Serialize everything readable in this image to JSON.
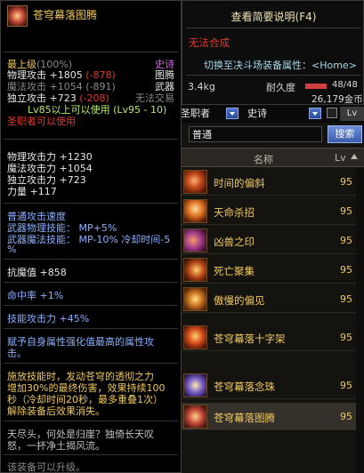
{
  "tooltip": {
    "item_name": "苍穹幕落图腾",
    "grade_label": "最上级",
    "grade_pct": "(100%)",
    "rarity": "史诗",
    "category1": "图腾",
    "category2": "武器",
    "trade": "无法交易",
    "phys_atk": "物理攻击 +1805",
    "phys_atk_diff": "(-878)",
    "mag_atk": "魔法攻击 +1054",
    "mag_atk_diff": "(-891)",
    "ind_atk": "独立攻击 +723",
    "ind_atk_diff": "(-208)",
    "level_req": "Lv85以上可以使用 (Lv95 - 10)",
    "class_req": "圣职者可以使用",
    "stat1": "物理攻击力 +1230",
    "stat2": "魔法攻击力 +1054",
    "stat3": "独立攻击力 +723",
    "stat4": "力量 +117",
    "atk_speed": "普通攻击速度",
    "skill_phys": "武器物理技能： MP+5%",
    "skill_mag": "武器魔法技能： MP-10% 冷却时间-5",
    "skill_mag_cont": "%",
    "resist": "抗魔值 +858",
    "hit_rate": "命中率 +1%",
    "skill_atk": "技能攻击力 +45%",
    "enchant_desc_1": "赋予自身属性强化值最高的属性攻",
    "enchant_desc_2": "击。",
    "effect_1": "施放技能时，发动苍穹的透彻之力",
    "effect_2": "增加30%的最终伤害，效果持续100",
    "effect_3": "秒（冷却时间20秒，最多重叠1次）",
    "effect_4": "解除装备后效果消失。",
    "flavor_1": "天尽头，何处是归崖？独倚长天叹",
    "flavor_2": "怒，一抔净土揭风流。",
    "upgrade": "该装备可以升级。"
  },
  "compare": {
    "title": "查看简要说明(F4)",
    "no_synth": "无法合成",
    "pvp_label": "切换至决斗场装备属性：<Home>",
    "weight": "3.4kg",
    "durability_label": "耐久度",
    "durability_value": "48/48",
    "durability_pct": 1.0,
    "price": "26,179金币"
  },
  "filter": {
    "class_value": "圣职者",
    "rarity_value": "史诗",
    "lv_toggle": "Lv"
  },
  "search": {
    "value": "普通",
    "button": "搜索"
  },
  "list": {
    "header_name": "名称",
    "header_lv": "Lv",
    "items": [
      {
        "name": "时间的偏斜",
        "lv": "95"
      },
      {
        "name": "天命杀招",
        "lv": "95"
      },
      {
        "name": "凶兽之印",
        "lv": "95"
      },
      {
        "name": "死亡聚集",
        "lv": "95"
      },
      {
        "name": "傲慢的偏见",
        "lv": "95"
      },
      {
        "name": "苍穹幕落十字架",
        "lv": "95"
      },
      {
        "name": "苍穹幕落念珠",
        "lv": "95"
      },
      {
        "name": "苍穹幕落图腾",
        "lv": "95"
      }
    ]
  },
  "colors": {
    "item_gold": "#f0c860",
    "warning_red": "#e03a2a",
    "accent_blue": "#3a5bab"
  }
}
